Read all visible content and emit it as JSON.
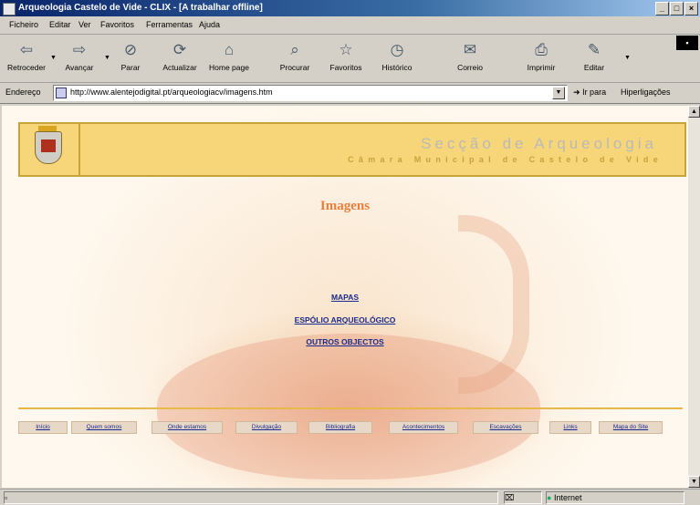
{
  "window": {
    "title": "Arqueologia Castelo de Vide - CLIX - [A trabalhar offline]"
  },
  "menu": [
    "Ficheiro",
    "Editar",
    "Ver",
    "Favoritos",
    "Ferramentas",
    "Ajuda"
  ],
  "toolbar": [
    {
      "label": "Retroceder",
      "icon": "back-arrow-icon"
    },
    {
      "label": "Avançar",
      "icon": "forward-arrow-icon"
    },
    {
      "label": "Parar",
      "icon": "stop-icon"
    },
    {
      "label": "Actualizar",
      "icon": "refresh-icon"
    },
    {
      "label": "Home page",
      "icon": "home-icon"
    },
    {
      "label": "Procurar",
      "icon": "search-icon"
    },
    {
      "label": "Favoritos",
      "icon": "favorites-icon"
    },
    {
      "label": "Histórico",
      "icon": "history-icon"
    },
    {
      "label": "Correio",
      "icon": "mail-icon"
    },
    {
      "label": "Imprimir",
      "icon": "print-icon"
    },
    {
      "label": "Editar",
      "icon": "edit-icon"
    }
  ],
  "address": {
    "label": "Endereço",
    "url": "http://www.alentejodigital.pt/arqueologiacv/imagens.htm",
    "go": "Ir para",
    "links": "Hiperligações"
  },
  "banner": {
    "title": "Secção de Arqueologia",
    "subtitle": "Câmara Municipal de Castelo de Vide"
  },
  "page": {
    "heading": "Imagens",
    "links": [
      "MAPAS",
      "ESPÓLIO ARQUEOLÓGICO",
      "OUTROS OBJECTOS"
    ]
  },
  "footer_nav": [
    "Início",
    "Quem somos",
    "Onde estamos",
    "Divulgação",
    "Bibliografia",
    "Acontecimentos",
    "Escavações",
    "Links",
    "Mapa do Site"
  ],
  "status": {
    "left": "",
    "zone": "Internet"
  },
  "colors": {
    "accent": "#e8803c",
    "banner_bg": "#f7d679",
    "link": "#1a2a8c"
  }
}
